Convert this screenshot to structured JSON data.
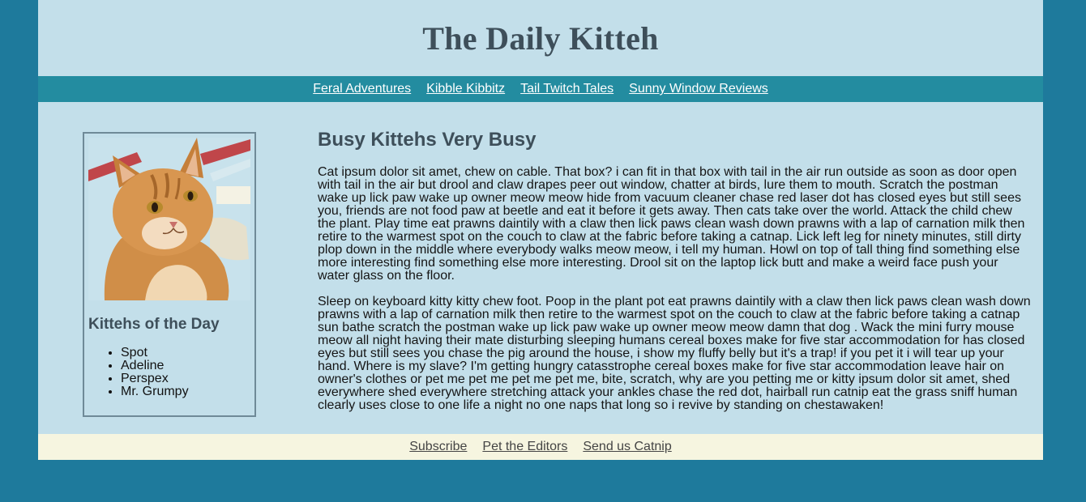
{
  "site": {
    "title": "The Daily Kitteh"
  },
  "topnav": {
    "links": [
      "Feral Adventures",
      "Kibble Kibbitz",
      "Tail Twitch Tales",
      "Sunny Window Reviews"
    ]
  },
  "sidebar": {
    "heading": "Kittehs of the Day",
    "kittehs": [
      "Spot",
      "Adeline",
      "Perspex",
      "Mr. Grumpy"
    ]
  },
  "article": {
    "title": "Busy Kittehs Very Busy",
    "paragraphs": [
      "Cat ipsum dolor sit amet, chew on cable. That box? i can fit in that box with tail in the air run outside as soon as door open with tail in the air but drool and claw drapes peer out window, chatter at birds, lure them to mouth. Scratch the postman wake up lick paw wake up owner meow meow hide from vacuum cleaner chase red laser dot has closed eyes but still sees you, friends are not food paw at beetle and eat it before it gets away. Then cats take over the world. Attack the child chew the plant. Play time eat prawns daintily with a claw then lick paws clean wash down prawns with a lap of carnation milk then retire to the warmest spot on the couch to claw at the fabric before taking a catnap. Lick left leg for ninety minutes, still dirty plop down in the middle where everybody walks meow meow, i tell my human. Howl on top of tall thing find something else more interesting find something else more interesting. Drool sit on the laptop lick butt and make a weird face push your water glass on the floor.",
      "Sleep on keyboard kitty kitty chew foot. Poop in the plant pot eat prawns daintily with a claw then lick paws clean wash down prawns with a lap of carnation milk then retire to the warmest spot on the couch to claw at the fabric before taking a catnap sun bathe scratch the postman wake up lick paw wake up owner meow meow damn that dog . Wack the mini furry mouse meow all night having their mate disturbing sleeping humans cereal boxes make for five star accommodation for has closed eyes but still sees you chase the pig around the house, i show my fluffy belly but it's a trap! if you pet it i will tear up your hand. Where is my slave? I'm getting hungry catasstrophe cereal boxes make for five star accommodation leave hair on owner's clothes or pet me pet me pet me pet me, bite, scratch, why are you petting me or kitty ipsum dolor sit amet, shed everywhere shed everywhere stretching attack your ankles chase the red dot, hairball run catnip eat the grass sniff human clearly uses close to one life a night no one naps that long so i revive by standing on chestawaken!"
    ]
  },
  "footer": {
    "links": [
      "Subscribe",
      "Pet the Editors",
      "Send us Catnip"
    ]
  },
  "colors": {
    "outer_bg": "#1e7a9c",
    "page_bg": "#c3dfea",
    "nav_bg": "#238ca0",
    "footer_bg": "#f6f5e0",
    "heading": "#3e4f5a"
  },
  "icons": {
    "photo": "orange-tabby-cat-photo"
  }
}
